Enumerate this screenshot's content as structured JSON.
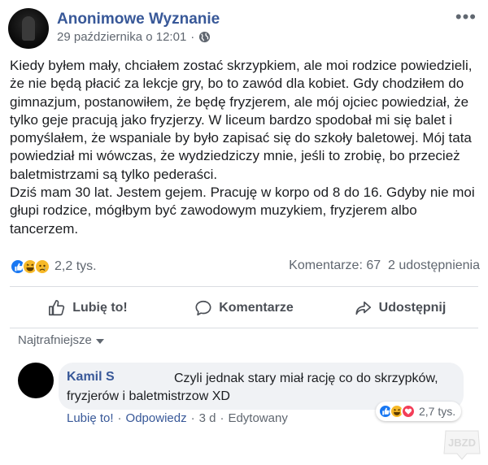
{
  "post": {
    "page_name": "Anonimowe Wyznanie",
    "timestamp": "29 października o 12:01",
    "separator": "·",
    "body": "Kiedy byłem mały, chciałem zostać skrzypkiem, ale moi rodzice powiedzieli, że nie będą płacić za lekcje gry, bo to zawód dla kobiet. Gdy chodziłem do gimnazjum, postanowiłem, że będę fryzjerem, ale mój ojciec powiedział, że tylko geje pracują jako fryzjerzy. W liceum bardzo spodobał mi się balet i pomyślałem, że wspaniale by było zapisać się do szkoły baletowej. Mój tata powiedział mi wówczas, że wydziedziczy mnie, jeśli to zrobię, bo przecież baletmistrzami są tylko pederaści.\nDziś mam 30 lat. Jestem gejem. Pracuję w korpo od 8 do 16. Gdyby nie moi głupi rodzice, mógłbym być zawodowym muzykiem, fryzjerem albo tancerzem.",
    "reactions_count": "2,2 tys.",
    "comments_count": "Komentarze: 67",
    "shares_count": "2 udostępnienia"
  },
  "actions": {
    "like": "Lubię to!",
    "comment": "Komentarze",
    "share": "Udostępnij"
  },
  "sort": {
    "label": "Najtrafniejsze"
  },
  "comment": {
    "author": "Kamil S",
    "text": "Czyli jednak stary miał rację co do skrzypków, fryzjerów i baletmistrzow XD",
    "reactions_count": "2,7 tys.",
    "like_link": "Lubię to!",
    "reply_link": "Odpowiedz",
    "age": "3 d",
    "edited": "Edytowany",
    "dot": "·"
  },
  "icons": {
    "more": "more-dots-icon",
    "globe": "globe-icon",
    "like": "thumbs-up-icon",
    "comment": "speech-bubble-icon",
    "share": "share-arrow-icon",
    "sort_caret": "caret-down-icon"
  },
  "colors": {
    "link": "#385898",
    "meta": "#606770",
    "like_blue": "#1877f2",
    "love_red": "#f33e58",
    "haha_yellow": "#f7b928",
    "bubble_bg": "#f0f2f5"
  }
}
